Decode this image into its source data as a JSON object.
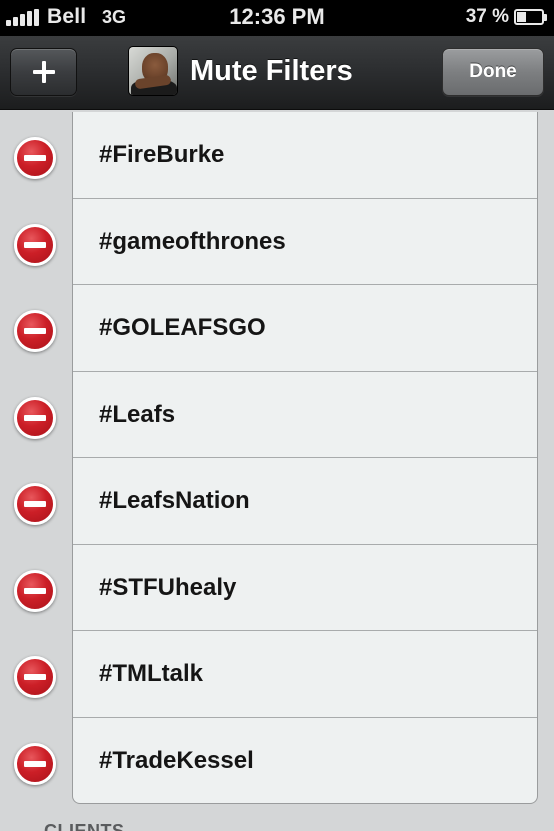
{
  "status_bar": {
    "carrier": "Bell",
    "network": "3G",
    "time": "12:36 PM",
    "battery_percent": "37 %",
    "battery_level": 0.37
  },
  "nav": {
    "title": "Mute Filters",
    "done_label": "Done",
    "add_icon": "plus-icon",
    "avatar_icon": "avatar"
  },
  "filters": [
    {
      "label": "#FireBurke"
    },
    {
      "label": "#gameofthrones"
    },
    {
      "label": "#GOLEAFSGO"
    },
    {
      "label": "#Leafs"
    },
    {
      "label": "#LeafsNation"
    },
    {
      "label": "#STFUhealy"
    },
    {
      "label": "#TMLtalk"
    },
    {
      "label": "#TradeKessel"
    }
  ],
  "next_section_label": "CLIENTS",
  "colors": {
    "delete_red": "#cc1f27",
    "nav_dark": "#2b2d2f",
    "row_bg": "#eef1f1",
    "page_bg": "#d4d6d7"
  }
}
